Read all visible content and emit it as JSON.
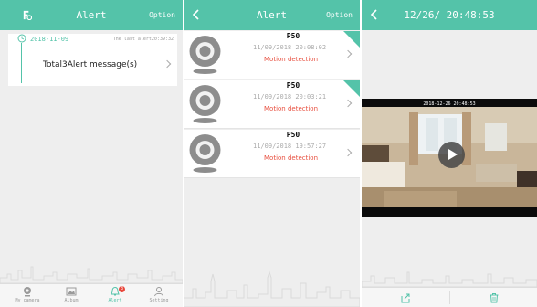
{
  "screen1": {
    "header": {
      "title": "Alert",
      "option": "Option",
      "logo_icon": "camera-logo-icon"
    },
    "card": {
      "date": "2018-11-09",
      "last_alert": "The last alert20:39:32",
      "message": "Total3Alert message(s)"
    },
    "tabs": [
      {
        "label": "My camera",
        "icon": "camera-icon"
      },
      {
        "label": "Album",
        "icon": "image-icon"
      },
      {
        "label": "Alert",
        "icon": "bell-icon",
        "badge": "3"
      },
      {
        "label": "Setting",
        "icon": "person-icon"
      }
    ]
  },
  "screen2": {
    "header": {
      "title": "Alert",
      "option": "Option"
    },
    "items": [
      {
        "name": "P50",
        "time": "11/09/2018 20:08:02",
        "event": "Motion detection"
      },
      {
        "name": "P50",
        "time": "11/09/2018 20:03:21",
        "event": "Motion detection"
      },
      {
        "name": "P50",
        "time": "11/09/2018 19:57:27",
        "event": "Motion detection"
      }
    ]
  },
  "screen3": {
    "header": {
      "title": "12/26/ 20:48:53"
    },
    "video_stamp": "2018-12-26 20:48:53",
    "bottom_icons": [
      "share-icon",
      "trash-icon"
    ]
  },
  "colors": {
    "accent": "#54c3a9",
    "alert_red": "#e84f3f",
    "background": "#eeeeee"
  }
}
